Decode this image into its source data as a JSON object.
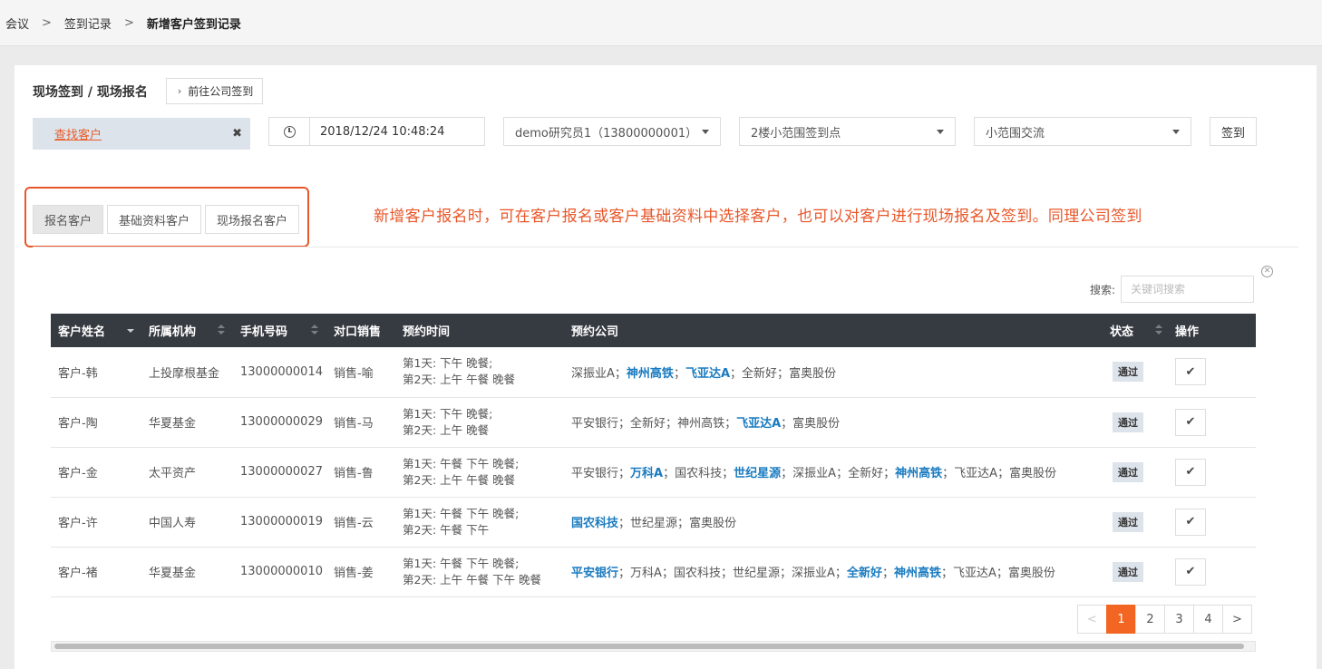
{
  "breadcrumb": [
    "会议",
    "签到记录",
    "新增客户签到记录"
  ],
  "breadcrumb_separator": ">",
  "panel": {
    "title": "现场签到 / 现场报名",
    "goto_label": "前往公司签到"
  },
  "find": {
    "label": "查找客户",
    "close": "✖"
  },
  "datetime": "2018/12/24 10:48:24",
  "selects": {
    "researcher": "demo研究员1（13800000001）",
    "location": "2楼小范围签到点",
    "activity": "小范围交流"
  },
  "signin_label": "签到",
  "tabs": [
    "报名客户",
    "基础资料客户",
    "现场报名客户"
  ],
  "annotation": "新增客户报名时，可在客户报名或客户基础资料中选择客户，也可以对客户进行现场报名及签到。同理公司签到",
  "search": {
    "label": "搜索:",
    "placeholder": "关键词搜索"
  },
  "table": {
    "headers": [
      "客户姓名",
      "所属机构",
      "手机号码",
      "对口销售",
      "预约时间",
      "预约公司",
      "状态",
      "操作"
    ],
    "rows": [
      {
        "name": "客户-韩",
        "org": "上投摩根基金",
        "phone": "13000000014",
        "sales": "销售-喻",
        "times": [
          "第1天: 下午 晚餐;",
          "第2天: 上午 午餐 晚餐"
        ],
        "companies": [
          {
            "text": "深振业A",
            "highlight": false
          },
          {
            "text": "神州高铁",
            "highlight": true
          },
          {
            "text": "飞亚达A",
            "highlight": true
          },
          {
            "text": "全新好",
            "highlight": false
          },
          {
            "text": "富奥股份",
            "highlight": false
          }
        ],
        "status": "通过"
      },
      {
        "name": "客户-陶",
        "org": "华夏基金",
        "phone": "13000000029",
        "sales": "销售-马",
        "times": [
          "第1天: 下午 晚餐;",
          "第2天: 上午 晚餐"
        ],
        "companies": [
          {
            "text": "平安银行",
            "highlight": false
          },
          {
            "text": "全新好",
            "highlight": false
          },
          {
            "text": "神州高铁",
            "highlight": false
          },
          {
            "text": "飞亚达A",
            "highlight": true
          },
          {
            "text": "富奥股份",
            "highlight": false
          }
        ],
        "status": "通过"
      },
      {
        "name": "客户-金",
        "org": "太平资产",
        "phone": "13000000027",
        "sales": "销售-鲁",
        "times": [
          "第1天: 午餐 下午 晚餐;",
          "第2天: 上午 午餐 晚餐"
        ],
        "companies": [
          {
            "text": "平安银行",
            "highlight": false
          },
          {
            "text": "万科A",
            "highlight": true
          },
          {
            "text": "国农科技",
            "highlight": false
          },
          {
            "text": "世纪星源",
            "highlight": true
          },
          {
            "text": "深振业A",
            "highlight": false
          },
          {
            "text": "全新好",
            "highlight": false
          },
          {
            "text": "神州高铁",
            "highlight": true
          },
          {
            "text": "飞亚达A",
            "highlight": false
          },
          {
            "text": "富奥股份",
            "highlight": false
          }
        ],
        "status": "通过"
      },
      {
        "name": "客户-许",
        "org": "中国人寿",
        "phone": "13000000019",
        "sales": "销售-云",
        "times": [
          "第1天: 午餐 下午 晚餐;",
          "第2天: 午餐 下午"
        ],
        "companies": [
          {
            "text": "国农科技",
            "highlight": true
          },
          {
            "text": "世纪星源",
            "highlight": false
          },
          {
            "text": "富奥股份",
            "highlight": false
          }
        ],
        "status": "通过"
      },
      {
        "name": "客户-褚",
        "org": "华夏基金",
        "phone": "13000000010",
        "sales": "销售-姜",
        "times": [
          "第1天: 午餐 下午 晚餐;",
          "第2天: 上午 午餐 下午 晚餐"
        ],
        "companies": [
          {
            "text": "平安银行",
            "highlight": true
          },
          {
            "text": "万科A",
            "highlight": false
          },
          {
            "text": "国农科技",
            "highlight": false
          },
          {
            "text": "世纪星源",
            "highlight": false
          },
          {
            "text": "深振业A",
            "highlight": false
          },
          {
            "text": "全新好",
            "highlight": true
          },
          {
            "text": "神州高铁",
            "highlight": true
          },
          {
            "text": "飞亚达A",
            "highlight": false
          },
          {
            "text": "富奥股份",
            "highlight": false
          }
        ],
        "status": "通过"
      }
    ],
    "action_icon": "✔"
  },
  "pagination": {
    "prev": "<",
    "pages": [
      "1",
      "2",
      "3",
      "4"
    ],
    "next": ">",
    "current": "1"
  },
  "colors": {
    "accent": "#f26522",
    "annotation": "#e8572a",
    "link_highlight": "#1a7bc0",
    "header_bg": "#363a41"
  }
}
